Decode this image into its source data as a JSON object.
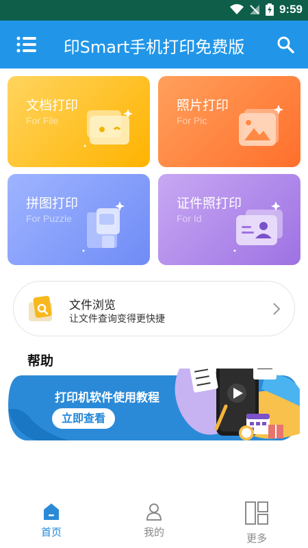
{
  "status_bar": {
    "time": "9:59"
  },
  "app_bar": {
    "title": "印Smart手机打印免费版"
  },
  "cards": [
    {
      "title": "文档打印",
      "subtitle": "For File"
    },
    {
      "title": "照片打印",
      "subtitle": "For Pic"
    },
    {
      "title": "拼图打印",
      "subtitle": "For Puzzle"
    },
    {
      "title": "证件照打印",
      "subtitle": "For Id"
    }
  ],
  "browse": {
    "title": "文件浏览",
    "subtitle": "让文件查询变得更快捷"
  },
  "help": {
    "heading": "帮助",
    "banner_title": "打印机软件使用教程",
    "banner_button": "立即查看"
  },
  "tabs": [
    {
      "label": "首页",
      "active": true
    },
    {
      "label": "我的",
      "active": false
    },
    {
      "label": "更多",
      "active": false
    }
  ],
  "colors": {
    "primary": "#2196e8",
    "status_bar": "#0e5e4a",
    "tab_active": "#1f86d9",
    "tab_inactive": "#888888"
  }
}
